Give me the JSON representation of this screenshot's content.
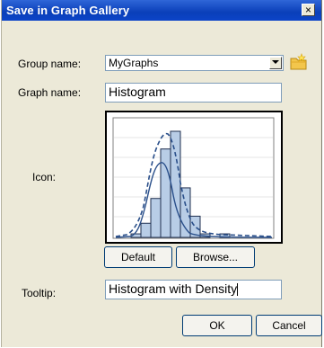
{
  "window": {
    "title": "Save in Graph Gallery",
    "close_glyph": "×"
  },
  "form": {
    "group_name_label": "Group name:",
    "group_name_value": "MyGraphs",
    "graph_name_label": "Graph name:",
    "graph_name_value": "Histogram",
    "icon_label": "Icon:",
    "tooltip_label": "Tooltip:",
    "tooltip_value": "Histogram with Density"
  },
  "buttons": {
    "default": "Default",
    "browse": "Browse...",
    "ok": "OK",
    "cancel": "Cancel"
  },
  "icons": {
    "dropdown": "chevron-down-icon",
    "new_group": "new-folder-icon",
    "close": "close-icon"
  },
  "colors": {
    "title_bar": "#0a3fb9",
    "dialog_bg": "#ece9d8",
    "histogram_fill": "#b8cde6",
    "density_curve": "#2a4f8a"
  },
  "preview": {
    "histogram_bins": [
      1,
      4,
      11,
      25,
      30,
      14,
      6,
      1,
      0,
      1
    ]
  }
}
